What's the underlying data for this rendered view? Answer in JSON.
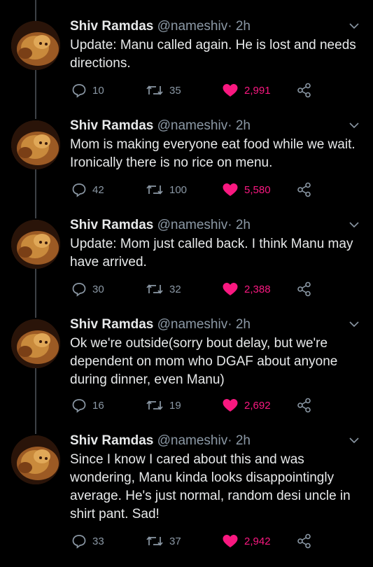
{
  "author": {
    "name": "Shiv Ramdas",
    "handle": "@nameshiv",
    "separator": "·",
    "time": "2h"
  },
  "tweets": [
    {
      "text": "Update: Manu called again. He is lost and needs directions.",
      "replies": "10",
      "retweets": "35",
      "likes": "2,991"
    },
    {
      "text": "Mom is making everyone eat food while we wait. Ironically there is no rice on menu.",
      "replies": "42",
      "retweets": "100",
      "likes": "5,580"
    },
    {
      "text": "Update: Mom just called back. I think Manu may have arrived.",
      "replies": "30",
      "retweets": "32",
      "likes": "2,388"
    },
    {
      "text": "Ok we're outside(sorry bout delay, but we're dependent on mom who DGAF about anyone during dinner, even Manu)",
      "replies": "16",
      "retweets": "19",
      "likes": "2,692"
    },
    {
      "text": "Since I know I cared about this and was wondering, Manu kinda looks disappointingly average. He's just  normal, random desi uncle in shirt pant. Sad!",
      "replies": "33",
      "retweets": "37",
      "likes": "2,942"
    }
  ],
  "colors": {
    "background": "#000000",
    "text": "#e7e9ea",
    "muted": "#8b98a5",
    "like": "#f91880",
    "thread_line": "#3d4146"
  },
  "icons": {
    "reply": "reply-icon",
    "retweet": "retweet-icon",
    "like": "heart-icon",
    "share": "share-icon",
    "more": "chevron-down-icon"
  }
}
